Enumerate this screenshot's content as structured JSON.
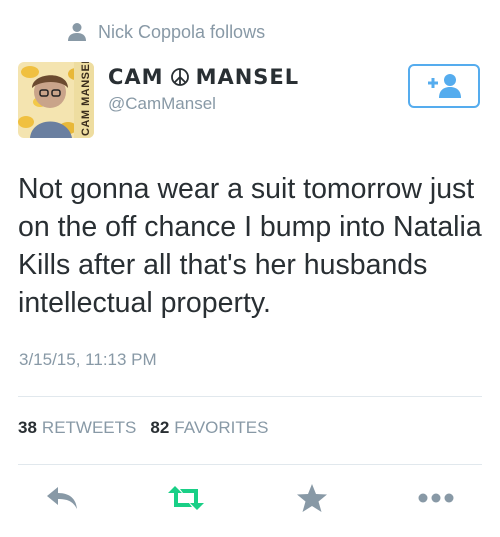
{
  "follow_context": {
    "text": "Nick Coppola follows",
    "icon": "person-icon"
  },
  "user": {
    "name_left": "CAM",
    "name_right": "MANSEL",
    "name_icon": "peace-sign-icon",
    "handle": "@CamMansel",
    "avatar_label": "CAM MANSEL"
  },
  "follow_button": {
    "icon": "add-user-icon",
    "color": "#55acee"
  },
  "tweet": {
    "text": "Not gonna wear a suit tomorrow just on the off chance I bump into Natalia Kills after all that's her husbands intellectual property.",
    "timestamp": "3/15/15, 11:13 PM"
  },
  "stats": {
    "retweets_count": "38",
    "retweets_label": "RETWEETS",
    "favorites_count": "82",
    "favorites_label": "FAVORITES"
  },
  "actions": [
    {
      "icon": "reply-icon",
      "color": "#8899a6"
    },
    {
      "icon": "retweet-icon",
      "color": "#19cf86"
    },
    {
      "icon": "favorite-star-icon",
      "color": "#8899a6"
    },
    {
      "icon": "more-dots-icon",
      "color": "#8899a6"
    }
  ]
}
